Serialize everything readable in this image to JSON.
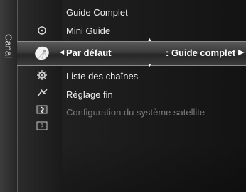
{
  "sidebar": {
    "tab_label": "Canal"
  },
  "menu": {
    "items": [
      {
        "label": "Guide Complet"
      },
      {
        "label": "Mini Guide"
      }
    ],
    "selected": {
      "label": "Par défaut",
      "value": ": Guide complet"
    },
    "items_after": [
      {
        "label": "Liste des chaînes"
      },
      {
        "label": "Réglage fin"
      },
      {
        "label": "Configuration du système satellite",
        "disabled": true
      }
    ]
  },
  "icons": {
    "side_icons": [
      "circle-icon",
      "satellite-dish-icon",
      "gear-icon",
      "antenna-icon",
      "channel-list-icon",
      "help-icon"
    ]
  }
}
